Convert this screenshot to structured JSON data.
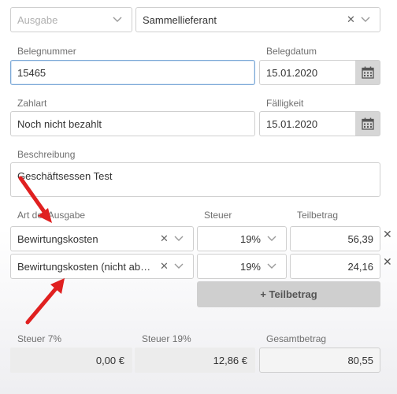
{
  "top": {
    "type_select": {
      "value": "Ausgabe",
      "placeholder": true
    },
    "supplier_select": {
      "value": "Sammellieferant"
    }
  },
  "beleg": {
    "number_label": "Belegnummer",
    "number_value": "15465",
    "date_label": "Belegdatum",
    "date_value": "15.01.2020"
  },
  "payment": {
    "label": "Zahlart",
    "value": "Noch nicht bezahlt",
    "due_label": "Fälligkeit",
    "due_value": "15.01.2020"
  },
  "description": {
    "label": "Beschreibung",
    "value": "Geschäftsessen Test"
  },
  "items": {
    "col_type": "Art der Ausgabe",
    "col_tax": "Steuer",
    "col_amount": "Teilbetrag",
    "rows": [
      {
        "type": "Bewirtungskosten",
        "tax": "19%",
        "amount": "56,39"
      },
      {
        "type": "Bewirtungskosten (nicht abziehbar)",
        "tax": "19%",
        "amount": "24,16"
      }
    ],
    "add_label": "+ Teilbetrag"
  },
  "totals": {
    "tax7_label": "Steuer 7%",
    "tax7_value": "0,00 €",
    "tax19_label": "Steuer 19%",
    "tax19_value": "12,86 €",
    "total_label": "Gesamtbetrag",
    "total_value": "80,55"
  },
  "colors": {
    "annotation_arrow": "#e02020",
    "calendar_bg": "#d6d6d6",
    "readonly_bg": "#ececec"
  },
  "icons": [
    "chevron-down-icon",
    "clear-icon",
    "calendar-icon",
    "remove-row-icon",
    "annotation-arrow"
  ]
}
